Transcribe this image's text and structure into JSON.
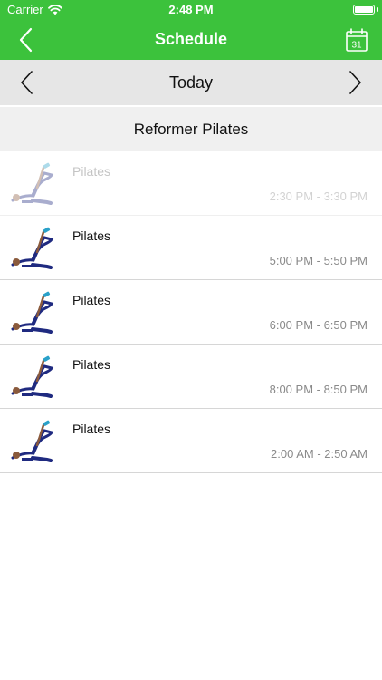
{
  "status_bar": {
    "carrier": "Carrier",
    "time": "2:48 PM"
  },
  "nav": {
    "title": "Schedule",
    "back_icon": "chevron-left-icon",
    "calendar_icon": "calendar-icon",
    "calendar_day": "31"
  },
  "date_bar": {
    "label": "Today",
    "prev_icon": "chevron-left-icon",
    "next_icon": "chevron-right-icon"
  },
  "section": {
    "title": "Reformer Pilates"
  },
  "classes": [
    {
      "name": "Pilates",
      "time": "2:30 PM - 3:30 PM",
      "past": true
    },
    {
      "name": "Pilates",
      "time": "5:00 PM - 5:50 PM",
      "past": false
    },
    {
      "name": "Pilates",
      "time": "6:00 PM - 6:50 PM",
      "past": false
    },
    {
      "name": "Pilates",
      "time": "8:00 PM - 8:50 PM",
      "past": false
    },
    {
      "name": "Pilates",
      "time": "2:00 AM - 2:50 AM",
      "past": false
    }
  ],
  "colors": {
    "accent": "#3cc23c",
    "date_bar_bg": "#e6e6e6",
    "section_bg": "#f0f0f0",
    "time_text": "#8a8a8a",
    "outfit": "#1f2a80"
  }
}
